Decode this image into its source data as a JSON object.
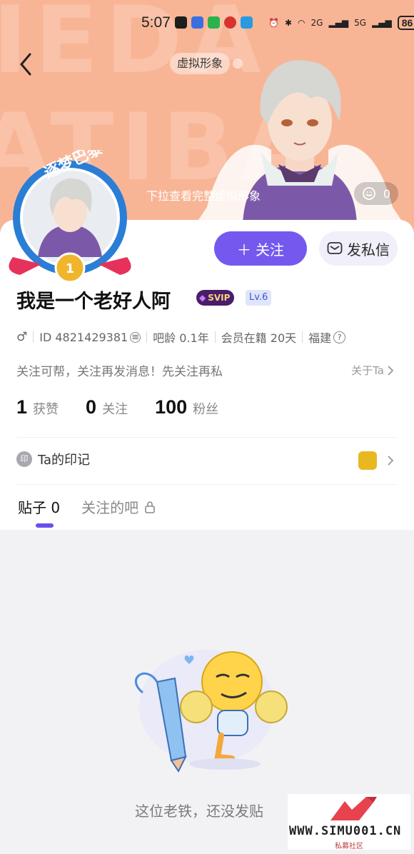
{
  "status_bar": {
    "time": "5:07",
    "battery": "86",
    "network_a": "2G",
    "network_b": "5G"
  },
  "banner": {
    "virtual_tag": "虚拟形象",
    "pull_hint": "下拉查看完整虚拟形象",
    "like_count": "0",
    "avatar_badge_text": "逐梦巴黎",
    "medal_number": "1"
  },
  "actions": {
    "follow_label": "关注",
    "message_label": "发私信"
  },
  "profile": {
    "username": "我是一个老好人阿",
    "svip": "SVIP",
    "level": "Lv.6",
    "gender_icon": "male-icon",
    "id_text": "ID 4821429381",
    "tieba_age": "吧龄 0.1年",
    "vip_duration": "会员在籍 20天",
    "location": "福建",
    "bio": "关注可帮，关注再发消息！先关注再私",
    "about_label": "关于Ta"
  },
  "stats": [
    {
      "num": "1",
      "label": "获赞"
    },
    {
      "num": "0",
      "label": "关注"
    },
    {
      "num": "100",
      "label": "粉丝"
    }
  ],
  "imprint": {
    "badge": "印",
    "label": "Ta的印记"
  },
  "tabs": {
    "posts": "贴子 0",
    "followed_bars": "关注的吧"
  },
  "empty_state": {
    "text": "这位老铁，还没发贴"
  },
  "watermark": {
    "url": "WWW.SIMU001.CN",
    "subtitle": "私募社区"
  },
  "colors": {
    "banner": "#f8b596",
    "accent": "#7559ee"
  }
}
